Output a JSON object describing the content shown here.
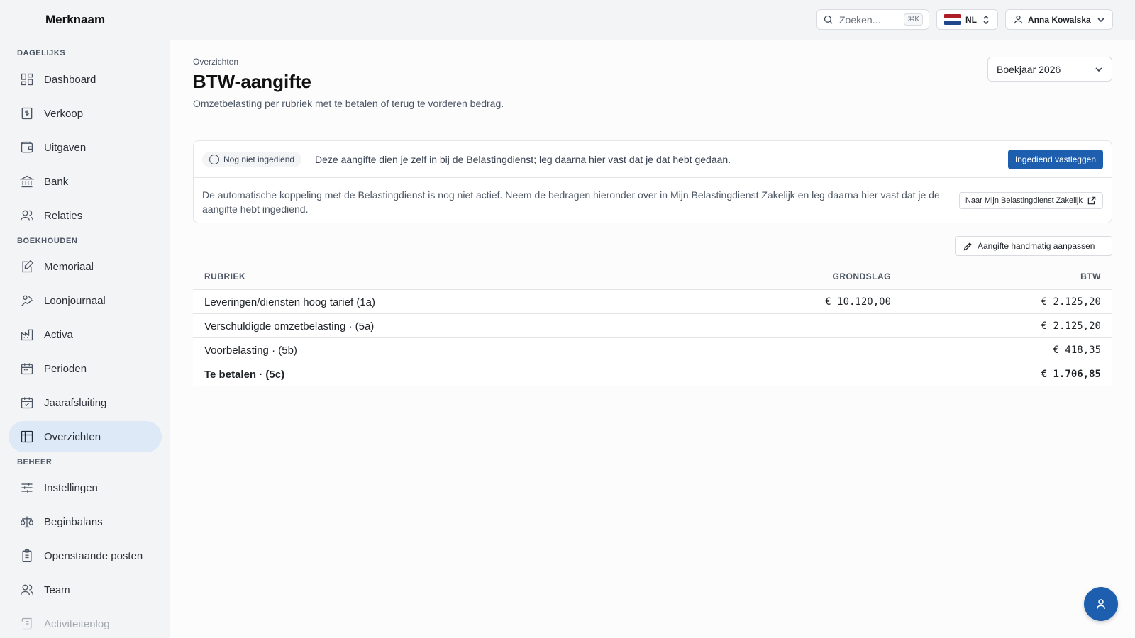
{
  "brand": "Merknaam",
  "search": {
    "placeholder": "Zoeken...",
    "shortcut": "⌘K"
  },
  "language": {
    "code": "NL",
    "flag_colors": [
      "#ae1c28",
      "#ffffff",
      "#21468b"
    ]
  },
  "user": {
    "name": "Anna Kowalska"
  },
  "sidebar": {
    "sections": [
      {
        "label": "DAGELIJKS"
      },
      {
        "label": "BOEKHOUDEN"
      },
      {
        "label": "BEHEER"
      }
    ],
    "items": [
      {
        "label": "Dashboard",
        "icon": "dashboard-icon"
      },
      {
        "label": "Verkoop",
        "icon": "invoice-icon"
      },
      {
        "label": "Uitgaven",
        "icon": "wallet-icon"
      },
      {
        "label": "Bank",
        "icon": "bank-icon"
      },
      {
        "label": "Relaties",
        "icon": "users-icon"
      },
      {
        "label": "Memoriaal",
        "icon": "journal-edit-icon"
      },
      {
        "label": "Loonjournaal",
        "icon": "salary-icon"
      },
      {
        "label": "Activa",
        "icon": "factory-icon"
      },
      {
        "label": "Perioden",
        "icon": "calendar-icon"
      },
      {
        "label": "Jaarafsluiting",
        "icon": "calendar-check-icon"
      },
      {
        "label": "Overzichten",
        "icon": "table-icon",
        "active": true
      },
      {
        "label": "Instellingen",
        "icon": "sliders-icon"
      },
      {
        "label": "Beginbalans",
        "icon": "scale-icon"
      },
      {
        "label": "Openstaande posten",
        "icon": "clipboard-list-icon"
      },
      {
        "label": "Team",
        "icon": "team-icon"
      },
      {
        "label": "Activiteitenlog",
        "icon": "scroll-icon"
      }
    ]
  },
  "page": {
    "breadcrumb": "Overzichten",
    "title": "BTW-aangifte",
    "subtitle": "Omzetbelasting per rubriek met te betalen of terug te vorderen bedrag.",
    "year_select": "Boekjaar 2026"
  },
  "status_card": {
    "badge": "Nog niet ingediend",
    "message": "Deze aangifte dien je zelf in bij de Belastingdienst; leg daarna hier vast dat je dat hebt gedaan.",
    "primary_button": "Ingediend vastleggen",
    "note": "De automatische koppeling met de Belastingdienst is nog niet actief. Neem de bedragen hieronder over in Mijn Belastingdienst Zakelijk en leg daarna hier vast dat je de aangifte hebt ingediend.",
    "external_button": "Naar Mijn Belastingdienst Zakelijk"
  },
  "edit_button": "Aangifte handmatig aanpassen",
  "table": {
    "headers": {
      "rubriek": "RUBRIEK",
      "grondslag": "GRONDSLAG",
      "btw": "BTW"
    },
    "rows": [
      {
        "rubriek": "Leveringen/diensten hoog tarief (1a)",
        "grondslag": "€ 10.120,00",
        "btw": "€ 2.125,20"
      },
      {
        "rubriek": "Verschuldigde omzetbelasting · (5a)",
        "grondslag": "",
        "btw": "€ 2.125,20"
      },
      {
        "rubriek": "Voorbelasting · (5b)",
        "grondslag": "",
        "btw": "€ 418,35"
      },
      {
        "rubriek": "Te betalen · (5c)",
        "grondslag": "",
        "btw": "€ 1.706,85"
      }
    ]
  },
  "colors": {
    "primary": "#1d5fae",
    "active_nav": "#dde9f7"
  }
}
